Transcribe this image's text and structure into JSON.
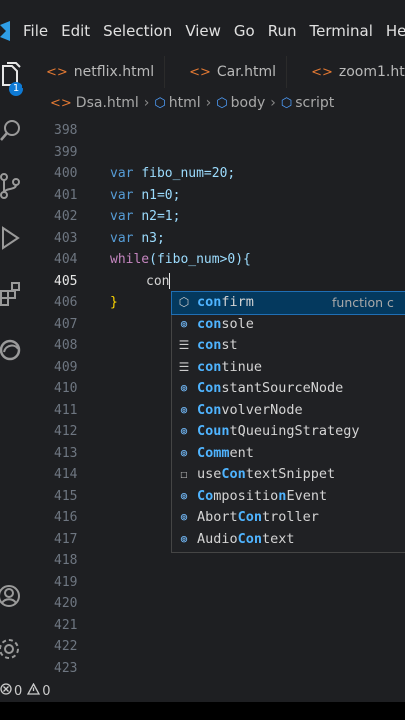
{
  "menubar": {
    "items": [
      "File",
      "Edit",
      "Selection",
      "View",
      "Go",
      "Run",
      "Terminal",
      "He"
    ]
  },
  "activity": {
    "badge": "1"
  },
  "tabs": [
    {
      "label": "netflix.html"
    },
    {
      "label": "Car.html"
    },
    {
      "label": "zoom1.ht"
    }
  ],
  "breadcrumb": [
    "Dsa.html",
    "html",
    "body",
    "script"
  ],
  "editor": {
    "lines": [
      {
        "n": "398",
        "text": ""
      },
      {
        "n": "399",
        "text": ""
      },
      {
        "n": "400",
        "kw": "var ",
        "rest": "fibo_num=20;"
      },
      {
        "n": "401",
        "kw": "var ",
        "rest": "n1=0;"
      },
      {
        "n": "402",
        "kw": "var ",
        "rest": "n2=1;"
      },
      {
        "n": "403",
        "kw": "var ",
        "rest": "n3;"
      },
      {
        "n": "404",
        "ctl": "while",
        "rest": "(fibo_num>0){"
      },
      {
        "n": "405",
        "typed": "con"
      },
      {
        "n": "406",
        "brace": "}"
      },
      {
        "n": "407"
      },
      {
        "n": "408"
      },
      {
        "n": "409"
      },
      {
        "n": "410"
      },
      {
        "n": "411"
      },
      {
        "n": "412"
      },
      {
        "n": "413"
      },
      {
        "n": "414"
      },
      {
        "n": "415"
      },
      {
        "n": "416"
      },
      {
        "n": "417"
      },
      {
        "n": "418"
      },
      {
        "n": "419"
      },
      {
        "n": "420"
      },
      {
        "n": "421"
      },
      {
        "n": "422"
      },
      {
        "n": "423"
      }
    ]
  },
  "suggestions": [
    {
      "pre": "",
      "match": "con",
      "post": "firm",
      "icon": "cube-icon",
      "detail": "function c"
    },
    {
      "pre": "",
      "match": "con",
      "post": "sole",
      "icon": "variable-icon"
    },
    {
      "pre": "",
      "match": "con",
      "post": "st",
      "icon": "keyword-icon"
    },
    {
      "pre": "",
      "match": "con",
      "post": "tinue",
      "icon": "keyword-icon"
    },
    {
      "pre": "",
      "match": "Con",
      "post": "stantSourceNode",
      "icon": "variable-icon"
    },
    {
      "pre": "",
      "match": "Con",
      "post": "volverNode",
      "icon": "variable-icon"
    },
    {
      "pre": "",
      "match": "Coun",
      "post": "tQueuingStrategy",
      "icon": "variable-icon"
    },
    {
      "pre": "",
      "match": "Comm",
      "post": "ent",
      "icon": "variable-icon"
    },
    {
      "pre": "use",
      "match": "Con",
      "post": "textSnippet",
      "icon": "snippet-icon"
    },
    {
      "pre": "",
      "match": "Co",
      "post": "mpositio",
      "post2": "n",
      "tail": "Event",
      "icon": "variable-icon"
    },
    {
      "pre": "Abort",
      "match": "Con",
      "post": "troller",
      "icon": "variable-icon"
    },
    {
      "pre": "Audio",
      "match": "Con",
      "post": "text",
      "icon": "variable-icon"
    }
  ],
  "status": {
    "errors": "0",
    "warnings": "0"
  }
}
